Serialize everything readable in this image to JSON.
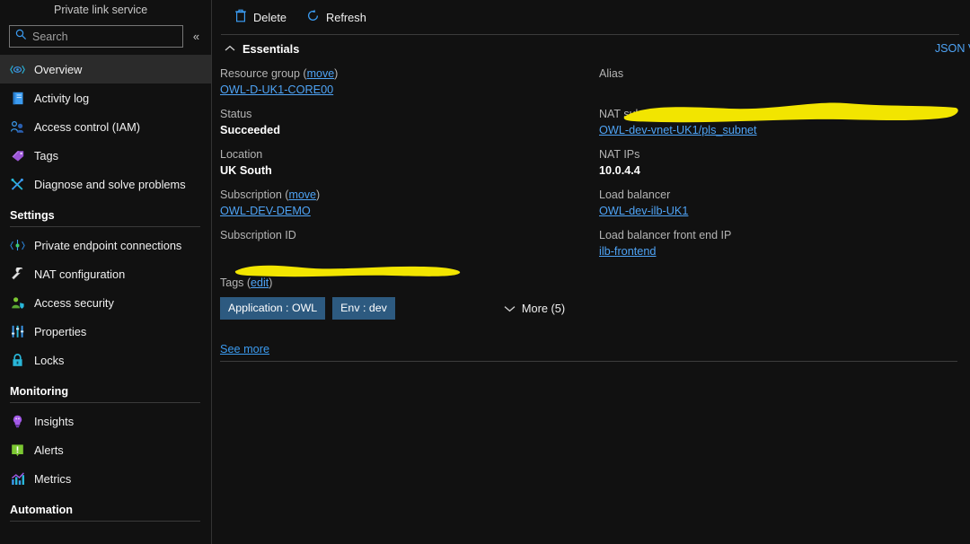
{
  "sidebar": {
    "resource_title": "Private link service",
    "search": {
      "placeholder": "Search",
      "value": ""
    },
    "collapse_label": "«",
    "items": [
      {
        "label": "Overview",
        "icon": "overview-eye-icon",
        "selected": true
      },
      {
        "label": "Activity log",
        "icon": "activity-log-icon",
        "selected": false
      },
      {
        "label": "Access control (IAM)",
        "icon": "access-control-people-icon",
        "selected": false
      },
      {
        "label": "Tags",
        "icon": "tag-icon",
        "selected": false
      },
      {
        "label": "Diagnose and solve problems",
        "icon": "diagnose-tools-icon",
        "selected": false
      }
    ],
    "groups": [
      {
        "title": "Settings",
        "items": [
          {
            "label": "Private endpoint connections",
            "icon": "private-endpoint-icon"
          },
          {
            "label": "NAT configuration",
            "icon": "wrench-icon"
          },
          {
            "label": "Access security",
            "icon": "access-security-shield-icon"
          },
          {
            "label": "Properties",
            "icon": "sliders-icon"
          },
          {
            "label": "Locks",
            "icon": "lock-icon"
          }
        ]
      },
      {
        "title": "Monitoring",
        "items": [
          {
            "label": "Insights",
            "icon": "lightbulb-icon"
          },
          {
            "label": "Alerts",
            "icon": "alert-exclamation-icon"
          },
          {
            "label": "Metrics",
            "icon": "metrics-chart-icon"
          }
        ]
      },
      {
        "title": "Automation",
        "items": []
      }
    ]
  },
  "toolbar": {
    "delete_label": "Delete",
    "refresh_label": "Refresh"
  },
  "essentials": {
    "section_label": "Essentials",
    "json_view_label": "JSON View",
    "left_fields": [
      {
        "label": "Resource group (",
        "label_link": "move",
        "label_suffix": ")",
        "value": "OWL-D-UK1-CORE00",
        "type": "link"
      },
      {
        "label": "Status",
        "value": "Succeeded",
        "type": "text"
      },
      {
        "label": "Location",
        "value": "UK South",
        "type": "text"
      },
      {
        "label": "Subscription (",
        "label_link": "move",
        "label_suffix": ")",
        "value": "OWL-DEV-DEMO",
        "type": "link"
      },
      {
        "label": "Subscription ID",
        "value": "",
        "type": "redacted"
      }
    ],
    "right_fields": [
      {
        "label": "Alias",
        "value": "",
        "type": "redacted"
      },
      {
        "label": "NAT subnet",
        "value": "OWL-dev-vnet-UK1/pls_subnet",
        "type": "link"
      },
      {
        "label": "NAT IPs",
        "value": "10.0.4.4",
        "type": "text"
      },
      {
        "label": "Load balancer",
        "value": "OWL-dev-ilb-UK1",
        "type": "link"
      },
      {
        "label": "Load balancer front end IP",
        "value": "ilb-frontend",
        "type": "link"
      }
    ],
    "tags": {
      "label_prefix": "Tags (",
      "edit_label": "edit",
      "label_suffix": ")",
      "chips": [
        "Application : OWL",
        "Env : dev"
      ],
      "more_label": "More (5)"
    },
    "see_more_label": "See more"
  },
  "colors": {
    "accent_link": "#4ea3f5",
    "chip_background": "#2d5a80",
    "selected_row": "#2b2b2b",
    "page_background": "#111111",
    "redaction_highlighter": "#f2e500"
  }
}
